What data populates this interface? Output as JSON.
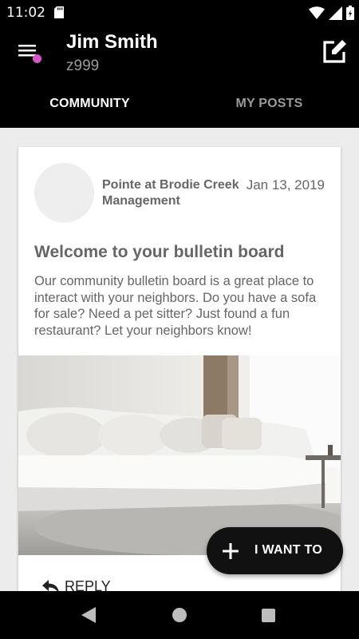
{
  "status_bar": {
    "time": "11:02",
    "icons": [
      "sd-card-icon",
      "wifi-icon",
      "signal-icon",
      "battery-icon"
    ]
  },
  "app_bar": {
    "user_name": "Jim Smith",
    "user_code": "z999",
    "menu_badge_color": "#d355c8"
  },
  "tabs": [
    {
      "label": "COMMUNITY",
      "active": true
    },
    {
      "label": "MY POSTS",
      "active": false
    }
  ],
  "post": {
    "author": "Pointe at Brodie Creek Management",
    "date": "Jan 13, 2019",
    "title": "Welcome to your bulletin board",
    "body": "Our community bulletin board is a great place to interact with your neighbors.  Do you have a sofa for sale?  Need a pet sitter?  Just found a fun restaurant?  Let your neighbors know!",
    "reply_label": "REPLY"
  },
  "fab": {
    "label": "I WANT TO"
  },
  "colors": {
    "background": "#000000",
    "content_bg": "#ececec",
    "text_muted": "#666666",
    "tab_inactive": "#9a9a9a"
  }
}
